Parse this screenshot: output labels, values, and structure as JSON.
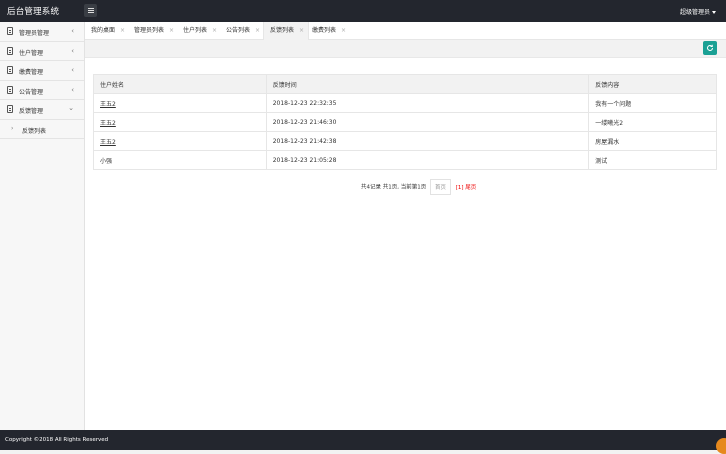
{
  "app": {
    "title": "后台管理系统",
    "user": "超级管理员"
  },
  "sidebar": {
    "items": [
      {
        "label": "管理员管理"
      },
      {
        "label": "住户管理"
      },
      {
        "label": "缴费管理"
      },
      {
        "label": "公告管理"
      },
      {
        "label": "反馈管理"
      }
    ],
    "sub_items": [
      {
        "label": "反馈列表"
      }
    ]
  },
  "tabs": [
    {
      "label": "我的桌面"
    },
    {
      "label": "管理员列表"
    },
    {
      "label": "住户列表"
    },
    {
      "label": "公告列表"
    },
    {
      "label": "反馈列表",
      "active": true
    },
    {
      "label": "缴费列表"
    }
  ],
  "table": {
    "headers": [
      "住户姓名",
      "反馈时间",
      "反馈内容"
    ],
    "rows": [
      [
        "王五2",
        "2018-12-23 22:32:35",
        "我有一个问题"
      ],
      [
        "王五2",
        "2018-12-23 21:46:30",
        "一缕曦光2"
      ],
      [
        "王五2",
        "2018-12-23 21:42:38",
        "房屋漏水"
      ],
      [
        "小强",
        "2018-12-23 21:05:28",
        "测试"
      ]
    ]
  },
  "pagination": {
    "summary": "共4记录 共1页, 当前第1页",
    "first": "首页",
    "last": "[1] 尾页"
  },
  "footer": {
    "copyright": "Copyright ©2018 All Rights Reserved"
  },
  "colors": {
    "header_bg": "#23262e",
    "accent": "#1aa094",
    "link_red": "#ee0000"
  }
}
